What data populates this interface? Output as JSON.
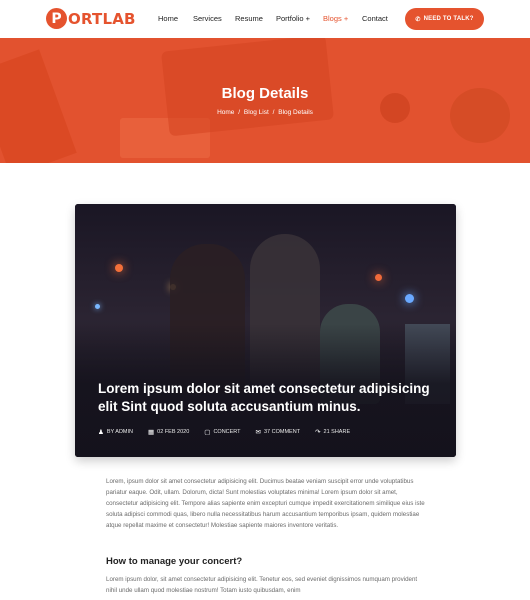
{
  "brand": {
    "logo_letter": "P",
    "logo_text": "ORTLAB",
    "accent": "#e5532e"
  },
  "nav": {
    "home": "Home",
    "services": "Services",
    "resume": "Resume",
    "portfolio": "Portfolio +",
    "blogs": "Blogs +",
    "contact": "Contact"
  },
  "cta": {
    "label": "NEED TO TALK?",
    "icon": "phone-icon"
  },
  "hero": {
    "title": "Blog Details",
    "breadcrumb": [
      "Home",
      "Blog List",
      "Blog Details"
    ],
    "separator": "/"
  },
  "post": {
    "title": "Lorem ipsum dolor sit amet consectetur adipisicing elit Sint quod soluta accusantium minus.",
    "meta": {
      "author": "BY ADMIN",
      "date": "02 FEB 2020",
      "category": "CONCERT",
      "comments": "37 COMMENT",
      "shares": "21 SHARE"
    },
    "paragraph1": "Lorem, ipsum dolor sit amet consectetur adipisicing elit. Ducimus beatae veniam suscipit error unde voluptatibus pariatur eaque. Odit, ullam. Dolorum, dicta! Sunt molestias voluptates minima! Lorem ipsum dolor sit amet, consectetur adipisicing elit. Tempore alias sapiente enim excepturi cumque impedit exercitationem similique eius iste soluta adipisci commodi quas, libero nulla necessitatibus harum accusantium temporibus ipsam, quidem molestiae atque repellat maxime et consectetur! Molestiae sapiente maiores inventore veritatis.",
    "heading": "How to manage your concert?",
    "paragraph2": "Lorem ipsum dolor, sit amet consectetur adipisicing elit. Tenetur eos, sed eveniet dignissimos numquam provident nihil unde ullam quod molestiae nostrum! Totam iusto quibusdam, enim"
  }
}
